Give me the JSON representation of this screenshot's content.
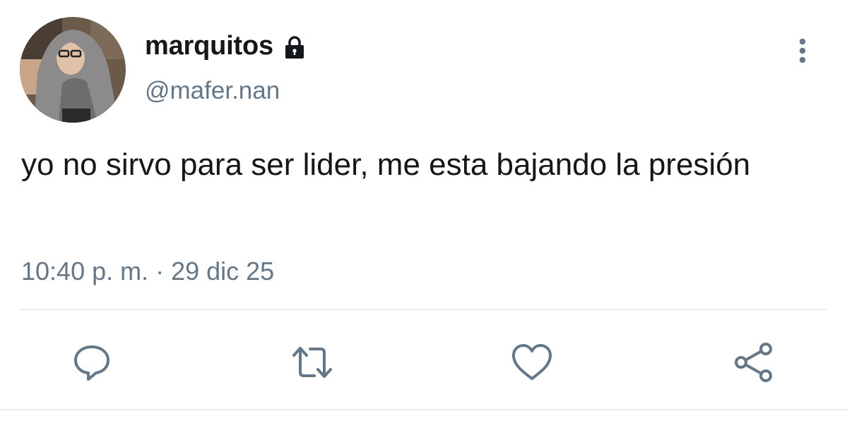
{
  "user": {
    "display_name": "marquitos",
    "handle": "@mafer.nan",
    "protected_icon": "lock-icon"
  },
  "tweet": {
    "text": "yo no sirvo para ser lider, me esta bajando la presión",
    "timestamp": "10:40 p. m. · 29 dic 25"
  },
  "actions": [
    {
      "name": "reply",
      "icon": "reply-icon"
    },
    {
      "name": "retweet",
      "icon": "retweet-icon"
    },
    {
      "name": "like",
      "icon": "heart-icon"
    },
    {
      "name": "share",
      "icon": "share-icon"
    }
  ],
  "colors": {
    "text_primary": "#14171a",
    "text_secondary": "#657786",
    "icon": "#657786",
    "divider": "#e6ecf0"
  }
}
